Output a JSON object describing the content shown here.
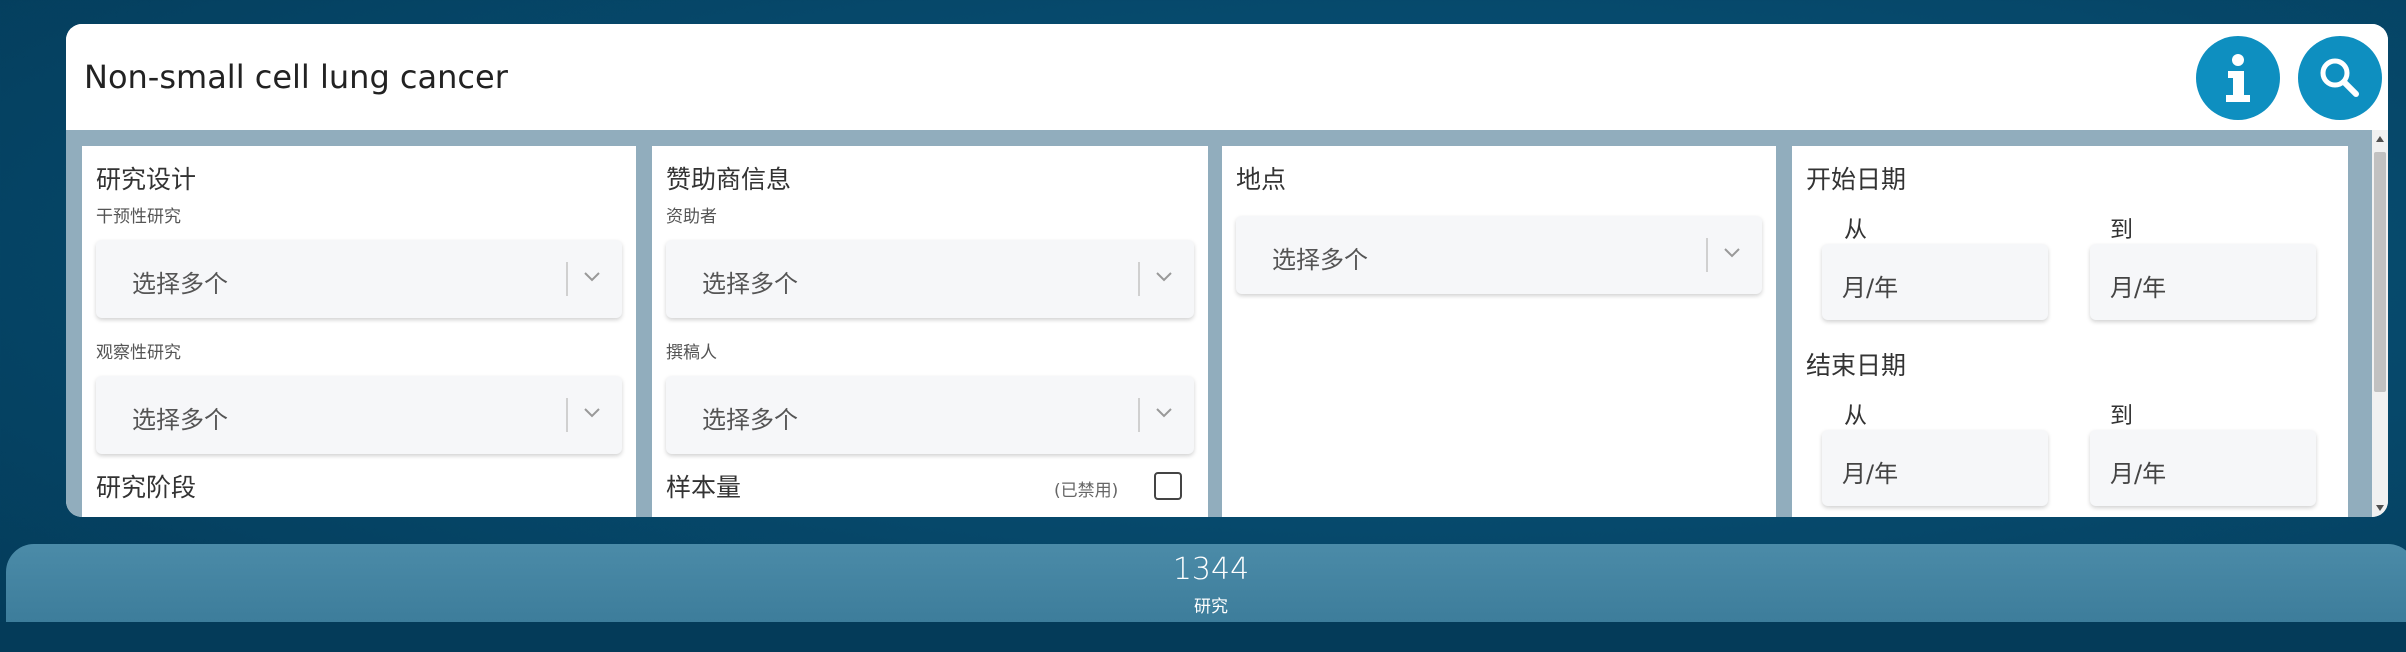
{
  "search": {
    "query": "Non-small cell lung cancer",
    "info_icon": "info-icon",
    "search_icon": "search-icon",
    "accent_color": "#0e8fc0"
  },
  "study_design": {
    "title": "研究设计",
    "interventional_label": "干预性研究",
    "interventional_placeholder": "选择多个",
    "observational_label": "观察性研究",
    "observational_placeholder": "选择多个",
    "phase_title": "研究阶段"
  },
  "sponsor": {
    "title": "赞助商信息",
    "funder_label": "资助者",
    "funder_placeholder": "选择多个",
    "author_label": "撰稿人",
    "author_placeholder": "选择多个",
    "sample_size_title": "样本量",
    "disabled_note": "(已禁用)"
  },
  "location": {
    "title": "地点",
    "placeholder": "选择多个"
  },
  "dates": {
    "start_title": "开始日期",
    "end_title": "结束日期",
    "from_label": "从",
    "to_label": "到",
    "placeholder": "月/年"
  },
  "results": {
    "count": "1344",
    "label": "研究"
  }
}
